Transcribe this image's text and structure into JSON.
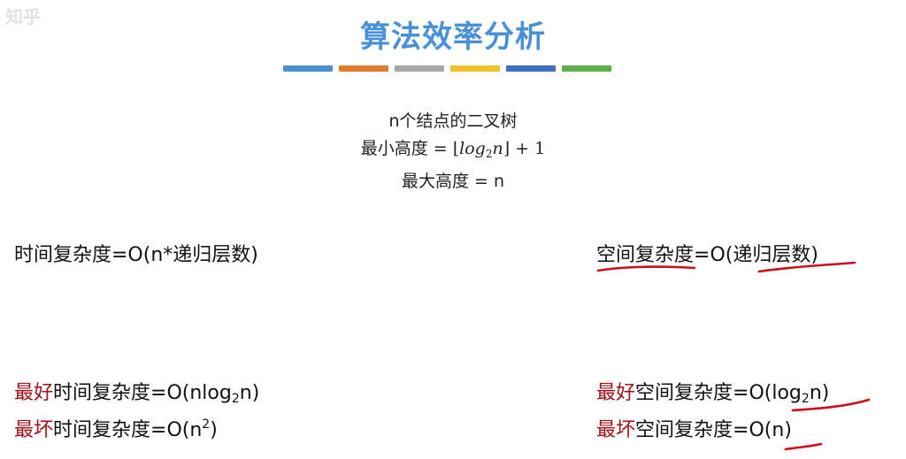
{
  "watermark": "知乎",
  "title": "算法效率分析",
  "color_bar": [
    "#4b8fcc",
    "#e07a30",
    "#a8a8a8",
    "#efc22a",
    "#3f6fbf",
    "#5eb04a"
  ],
  "tree_info": {
    "line1": "n个结点的二叉树",
    "min_height_label": "最小高度 =",
    "min_height_formula": {
      "open": "⌊",
      "log": "log",
      "base": "2",
      "arg": "n",
      "close": "⌋",
      "tail": "+ 1"
    },
    "max_height": "最大高度 = n"
  },
  "time_complexity": {
    "text": "时间复杂度=O(n*递归层数)"
  },
  "space_complexity": {
    "prefix": "空间复杂度",
    "mid": "=O(",
    "recursion": "递归层数",
    "close": ")"
  },
  "time_best": {
    "highlight": "最好",
    "text": "时间复杂度=O(nlog",
    "sub": "2",
    "tail": "n)"
  },
  "time_worst": {
    "highlight": "最坏",
    "text": "时间复杂度=O(n",
    "sup": "2",
    "tail": ")"
  },
  "space_best": {
    "highlight": "最好",
    "text": "空间复杂度=O(",
    "log": "log",
    "sub": "2",
    "arg": "n",
    "tail": ")"
  },
  "space_worst": {
    "highlight": "最坏",
    "text": "空间复杂度=O(",
    "arg": "n",
    "tail": ")"
  }
}
